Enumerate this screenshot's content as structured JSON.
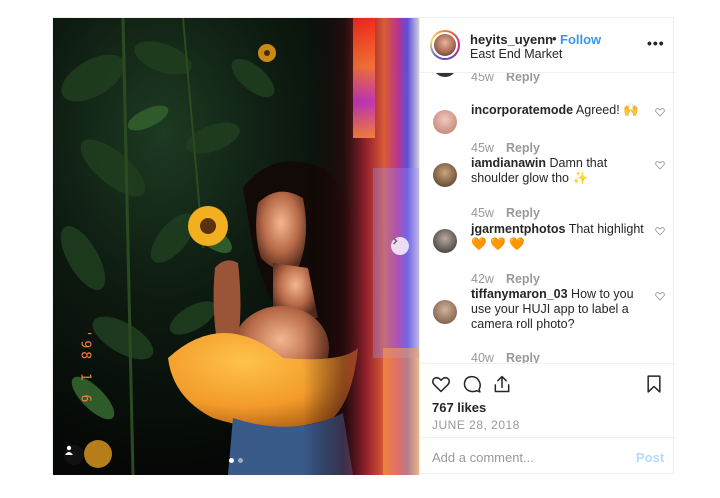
{
  "post": {
    "username": "heyits_uyenn",
    "separator": "•",
    "follow_label": "Follow",
    "location": "East End Market",
    "more_label": "•••",
    "photo_date_stamp": "'98 1 6"
  },
  "comments": [
    {
      "user": "",
      "text": "",
      "age": "45w",
      "reply": "Reply"
    },
    {
      "user": "incorporatemode",
      "text": "Agreed! 🙌",
      "age": "45w",
      "reply": "Reply"
    },
    {
      "user": "iamdianawin",
      "text": "Damn that shoulder glow tho ✨",
      "age": "45w",
      "reply": "Reply"
    },
    {
      "user": "jgarmentphotos",
      "text": "That highlight 🧡 🧡 🧡",
      "age": "42w",
      "reply": "Reply"
    },
    {
      "user": "tiffanymaron_03",
      "text": "How to you use your HUJI app to label a camera roll photo?",
      "age": "40w",
      "reply": "Reply"
    }
  ],
  "likes": "767 likes",
  "date": "JUNE 28, 2018",
  "comment_input": {
    "placeholder": "Add a comment...",
    "value": ""
  },
  "post_button": "Post",
  "icons": [
    "like-icon",
    "comment-icon",
    "share-icon",
    "save-icon",
    "comment-heart-icon",
    "next-arrow-icon",
    "user-tag-icon"
  ],
  "colors": {
    "accent": "#3897f0",
    "post_disabled": "#b3dbff",
    "muted": "#999999",
    "text": "#262626",
    "stamp": "#ff7a3c"
  }
}
